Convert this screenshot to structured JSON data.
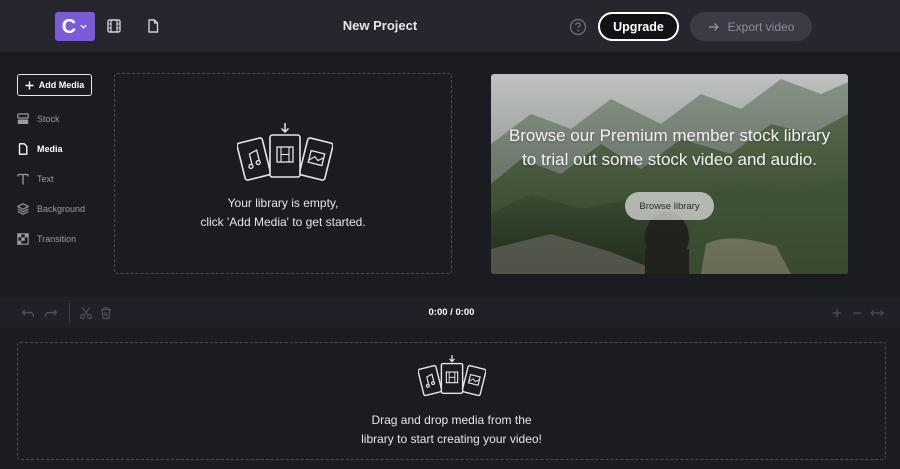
{
  "topbar": {
    "logo_letter": "C",
    "project_title": "New Project",
    "upgrade_label": "Upgrade",
    "export_label": "Export video"
  },
  "sidebar": {
    "add_media_label": "Add Media",
    "items": [
      {
        "label": "Stock",
        "icon": "stock-icon",
        "active": false
      },
      {
        "label": "Media",
        "icon": "media-icon",
        "active": true
      },
      {
        "label": "Text",
        "icon": "text-icon",
        "active": false
      },
      {
        "label": "Background",
        "icon": "background-icon",
        "active": false
      },
      {
        "label": "Transition",
        "icon": "transition-icon",
        "active": false
      }
    ]
  },
  "library": {
    "empty_line1": "Your library is empty,",
    "empty_line2": "click 'Add Media' to get started."
  },
  "stock_promo": {
    "line1": "Browse our Premium member stock library",
    "line2": "to trial out some stock video and audio.",
    "button_label": "Browse library"
  },
  "timeline": {
    "time_readout": "0:00 / 0:00",
    "drop_line1": "Drag and drop media from the",
    "drop_line2": "library to start creating your video!"
  },
  "colors": {
    "accent": "#7b5bd6",
    "background": "#1b1b22",
    "topbar": "#26262f"
  }
}
